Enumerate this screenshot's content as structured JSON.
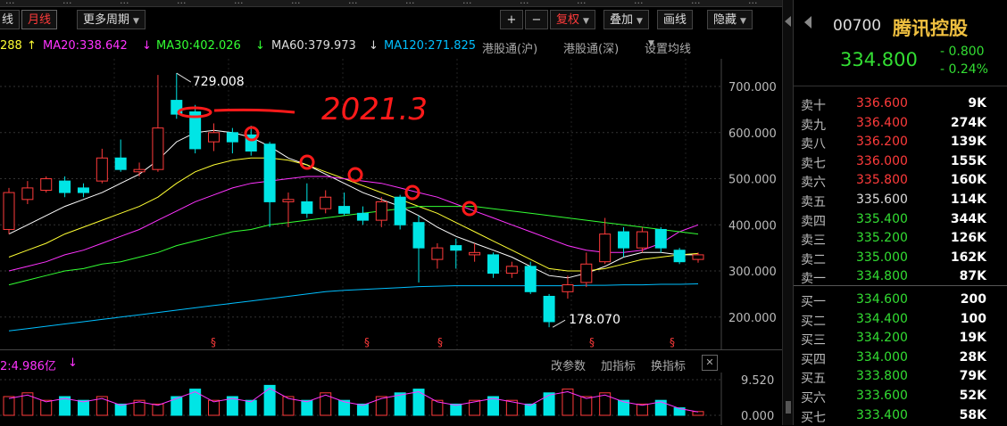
{
  "top_tabs": [
    "...",
    "...",
    "...",
    "...",
    "...",
    "...",
    "...",
    "...",
    "...",
    "...",
    "...",
    "...",
    "...",
    "..."
  ],
  "toolbar": {
    "left_fragment": "线",
    "monthly_label": "月线",
    "more_periods_label": "更多周期",
    "plus_label": "+",
    "minus_label": "−",
    "restore_label": "复权",
    "overlay_label": "叠加",
    "draw_line_label": "画线",
    "hide_label": "隐藏"
  },
  "ma_bar": {
    "ma10_fragment": "288",
    "ma10_arrow": "↑",
    "ma20": "MA20:338.642",
    "ma20_arrow": "↓",
    "ma30": "MA30:402.026",
    "ma30_arrow": "↓",
    "ma60": "MA60:379.973",
    "ma60_arrow": "↓",
    "ma120": "MA120:271.825",
    "hk_connect_sh": "港股通(沪)",
    "hk_connect_sz": "港股通(深)",
    "set_ma": "设置均线"
  },
  "annotations": {
    "high_label": "729.008",
    "low_label": "178.070",
    "handwritten_date": "2021.3"
  },
  "volume_header": {
    "ma_label": "2:4.986亿",
    "change_params": "改参数",
    "add_indicator": "加指标",
    "switch_indicator": "换指标",
    "close": "✕"
  },
  "chart_data": {
    "type": "candlestick",
    "ylim": [
      130,
      760
    ],
    "y_ticks": [
      "700.000",
      "600.000",
      "500.000",
      "400.000",
      "300.000",
      "200.000"
    ],
    "vol_ticks": [
      "9.520",
      "0.000"
    ],
    "candles": [
      {
        "o": 390,
        "c": 470,
        "h": 480,
        "l": 380
      },
      {
        "o": 455,
        "c": 480,
        "h": 495,
        "l": 445
      },
      {
        "o": 475,
        "c": 500,
        "h": 505,
        "l": 470
      },
      {
        "o": 495,
        "c": 470,
        "h": 505,
        "l": 460
      },
      {
        "o": 480,
        "c": 470,
        "h": 490,
        "l": 460
      },
      {
        "o": 495,
        "c": 545,
        "h": 565,
        "l": 490
      },
      {
        "o": 545,
        "c": 520,
        "h": 585,
        "l": 515
      },
      {
        "o": 515,
        "c": 520,
        "h": 535,
        "l": 505
      },
      {
        "o": 520,
        "c": 610,
        "h": 725,
        "l": 515
      },
      {
        "o": 670,
        "c": 640,
        "h": 729,
        "l": 630
      },
      {
        "o": 645,
        "c": 565,
        "h": 660,
        "l": 555
      },
      {
        "o": 580,
        "c": 600,
        "h": 620,
        "l": 560
      },
      {
        "o": 600,
        "c": 580,
        "h": 610,
        "l": 555
      },
      {
        "o": 595,
        "c": 560,
        "h": 615,
        "l": 550
      },
      {
        "o": 575,
        "c": 450,
        "h": 580,
        "l": 395
      },
      {
        "o": 450,
        "c": 455,
        "h": 470,
        "l": 395
      },
      {
        "o": 450,
        "c": 425,
        "h": 490,
        "l": 415
      },
      {
        "o": 435,
        "c": 460,
        "h": 475,
        "l": 425
      },
      {
        "o": 440,
        "c": 425,
        "h": 470,
        "l": 420
      },
      {
        "o": 425,
        "c": 410,
        "h": 440,
        "l": 400
      },
      {
        "o": 410,
        "c": 450,
        "h": 460,
        "l": 395
      },
      {
        "o": 460,
        "c": 400,
        "h": 465,
        "l": 390
      },
      {
        "o": 405,
        "c": 350,
        "h": 420,
        "l": 275
      },
      {
        "o": 325,
        "c": 350,
        "h": 360,
        "l": 305
      },
      {
        "o": 355,
        "c": 345,
        "h": 370,
        "l": 305
      },
      {
        "o": 335,
        "c": 340,
        "h": 360,
        "l": 320
      },
      {
        "o": 335,
        "c": 295,
        "h": 340,
        "l": 285
      },
      {
        "o": 295,
        "c": 310,
        "h": 320,
        "l": 285
      },
      {
        "o": 310,
        "c": 255,
        "h": 320,
        "l": 250
      },
      {
        "o": 245,
        "c": 190,
        "h": 250,
        "l": 178
      },
      {
        "o": 255,
        "c": 270,
        "h": 290,
        "l": 240
      },
      {
        "o": 275,
        "c": 315,
        "h": 340,
        "l": 265
      },
      {
        "o": 320,
        "c": 380,
        "h": 415,
        "l": 315
      },
      {
        "o": 385,
        "c": 350,
        "h": 395,
        "l": 330
      },
      {
        "o": 350,
        "c": 385,
        "h": 395,
        "l": 340
      },
      {
        "o": 390,
        "c": 350,
        "h": 395,
        "l": 340
      },
      {
        "o": 345,
        "c": 320,
        "h": 350,
        "l": 315
      },
      {
        "o": 325,
        "c": 335,
        "h": 340,
        "l": 318
      }
    ],
    "volumes": [
      5,
      6,
      4,
      5,
      4,
      5,
      3,
      4,
      3,
      5,
      7,
      4,
      5,
      4,
      8,
      5,
      4,
      6,
      4,
      3,
      5,
      6,
      7,
      4,
      3,
      4,
      5,
      4,
      3,
      6,
      7,
      5,
      6,
      4,
      3,
      4,
      2,
      1
    ],
    "series": [
      {
        "name": "MA10",
        "values": [
          380,
          400,
          420,
          440,
          455,
          470,
          490,
          510,
          540,
          580,
          600,
          605,
          600,
          590,
          570,
          545,
          530,
          510,
          490,
          470,
          455,
          440,
          420,
          395,
          375,
          360,
          345,
          330,
          310,
          290,
          285,
          295,
          310,
          330,
          340,
          340,
          335,
          335
        ]
      },
      {
        "name": "MA20",
        "values": [
          330,
          345,
          360,
          380,
          395,
          410,
          425,
          440,
          460,
          490,
          515,
          530,
          540,
          545,
          545,
          540,
          530,
          515,
          500,
          485,
          470,
          455,
          440,
          425,
          405,
          385,
          365,
          345,
          325,
          305,
          300,
          300,
          305,
          315,
          325,
          330,
          335,
          338
        ]
      },
      {
        "name": "MA30",
        "values": [
          300,
          310,
          320,
          335,
          345,
          360,
          375,
          390,
          410,
          430,
          450,
          465,
          480,
          490,
          495,
          500,
          505,
          505,
          500,
          495,
          490,
          480,
          470,
          460,
          445,
          430,
          415,
          400,
          385,
          370,
          355,
          345,
          340,
          340,
          345,
          360,
          385,
          400
        ]
      },
      {
        "name": "MA60",
        "values": [
          270,
          280,
          290,
          300,
          305,
          315,
          320,
          330,
          340,
          355,
          365,
          375,
          385,
          390,
          400,
          405,
          410,
          415,
          420,
          425,
          430,
          435,
          440,
          440,
          440,
          440,
          435,
          430,
          425,
          420,
          415,
          410,
          405,
          400,
          395,
          390,
          385,
          380
        ]
      },
      {
        "name": "MA120",
        "values": [
          170,
          175,
          180,
          185,
          190,
          195,
          200,
          205,
          210,
          215,
          220,
          225,
          230,
          235,
          240,
          245,
          250,
          255,
          258,
          260,
          262,
          264,
          266,
          267,
          268,
          268,
          268,
          268,
          268,
          268,
          268,
          269,
          269,
          270,
          270,
          271,
          271,
          272
        ]
      }
    ]
  },
  "colors": {
    "up": "#ff3b3b",
    "down": "#00e5e5",
    "ma10": "#ffffff",
    "ma20": "#ffff33",
    "ma30": "#ff33ff",
    "ma60": "#33ff33",
    "ma120": "#00bfff",
    "green_text": "#33dd33",
    "gold": "#f0c040"
  },
  "quote": {
    "code": "00700",
    "name": "腾讯控股",
    "price": "334.800",
    "change": "- 0.800",
    "change_pct": "- 0.24%"
  },
  "asks": [
    {
      "label": "卖十",
      "price": "336.600",
      "vol": "9K",
      "color": "#ff3b3b"
    },
    {
      "label": "卖九",
      "price": "336.400",
      "vol": "274K",
      "color": "#ff3b3b"
    },
    {
      "label": "卖八",
      "price": "336.200",
      "vol": "139K",
      "color": "#ff3b3b"
    },
    {
      "label": "卖七",
      "price": "336.000",
      "vol": "155K",
      "color": "#ff3b3b"
    },
    {
      "label": "卖六",
      "price": "335.800",
      "vol": "160K",
      "color": "#ff3b3b"
    },
    {
      "label": "卖五",
      "price": "335.600",
      "vol": "114K",
      "color": "#dddddd"
    },
    {
      "label": "卖四",
      "price": "335.400",
      "vol": "344K",
      "color": "#33dd33"
    },
    {
      "label": "卖三",
      "price": "335.200",
      "vol": "126K",
      "color": "#33dd33"
    },
    {
      "label": "卖二",
      "price": "335.000",
      "vol": "162K",
      "color": "#33dd33"
    },
    {
      "label": "卖一",
      "price": "334.800",
      "vol": "87K",
      "color": "#33dd33"
    }
  ],
  "bids": [
    {
      "label": "买一",
      "price": "334.600",
      "vol": "200",
      "color": "#33dd33"
    },
    {
      "label": "买二",
      "price": "334.400",
      "vol": "100",
      "color": "#33dd33"
    },
    {
      "label": "买三",
      "price": "334.200",
      "vol": "19K",
      "color": "#33dd33"
    },
    {
      "label": "买四",
      "price": "334.000",
      "vol": "28K",
      "color": "#33dd33"
    },
    {
      "label": "买五",
      "price": "333.800",
      "vol": "79K",
      "color": "#33dd33"
    },
    {
      "label": "买六",
      "price": "333.600",
      "vol": "52K",
      "color": "#33dd33"
    },
    {
      "label": "买七",
      "price": "333.400",
      "vol": "58K",
      "color": "#33dd33"
    }
  ]
}
